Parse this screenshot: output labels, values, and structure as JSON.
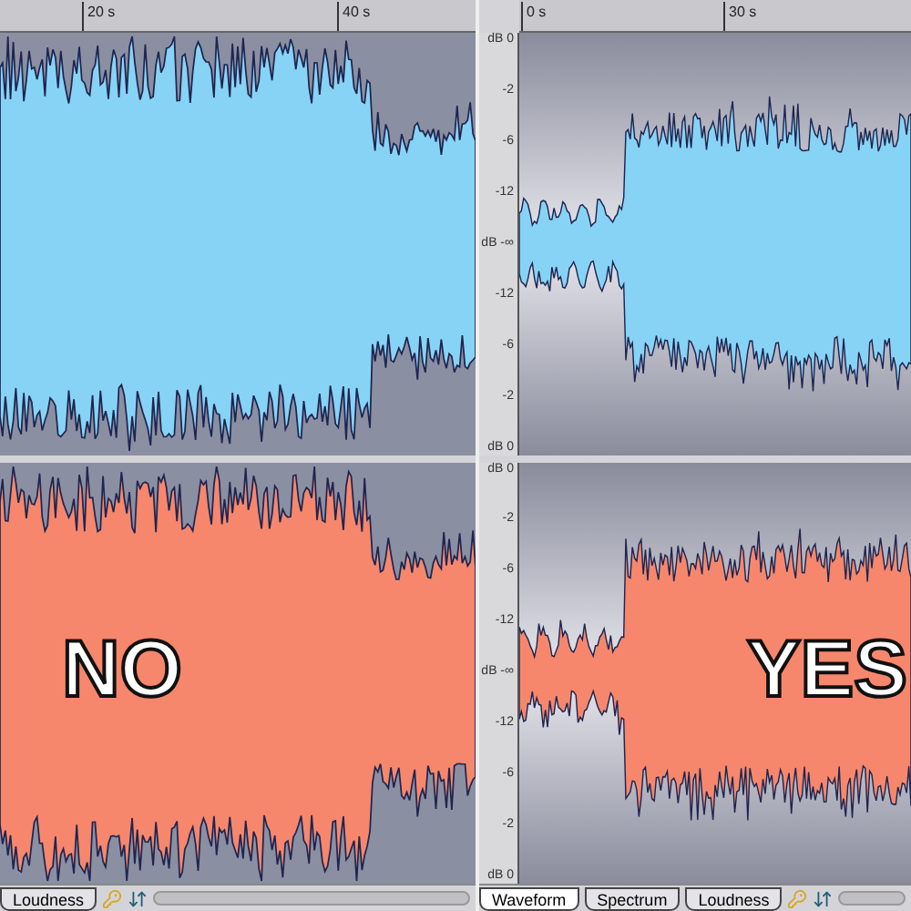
{
  "editors": [
    {
      "ruler_ticks": [
        "20 s",
        "40 s"
      ],
      "shows_scale": false,
      "quiet_intro": false,
      "channels": [
        {
          "color": "#87d3f5"
        },
        {
          "color": "#f6876c",
          "caption": "NO"
        }
      ],
      "tabs": [
        {
          "label": "Loudness",
          "selected": false
        }
      ]
    },
    {
      "ruler_ticks": [
        "0 s",
        "30 s"
      ],
      "shows_scale": true,
      "quiet_intro": true,
      "channels": [
        {
          "color": "#87d3f5",
          "scale_labels": [
            "dB 0",
            "-2",
            "-6",
            "-12",
            "dB -∞",
            "-12",
            "-6",
            "-2",
            "dB 0"
          ]
        },
        {
          "color": "#f6876c",
          "caption": "YES",
          "scale_labels": [
            "dB 0",
            "-2",
            "-6",
            "-12",
            "dB -∞",
            "-12",
            "-6",
            "-2",
            "dB 0"
          ]
        }
      ],
      "tabs": [
        {
          "label": "Waveform",
          "selected": true
        },
        {
          "label": "Spectrum",
          "selected": false
        },
        {
          "label": "Loudness",
          "selected": false
        }
      ]
    }
  ]
}
